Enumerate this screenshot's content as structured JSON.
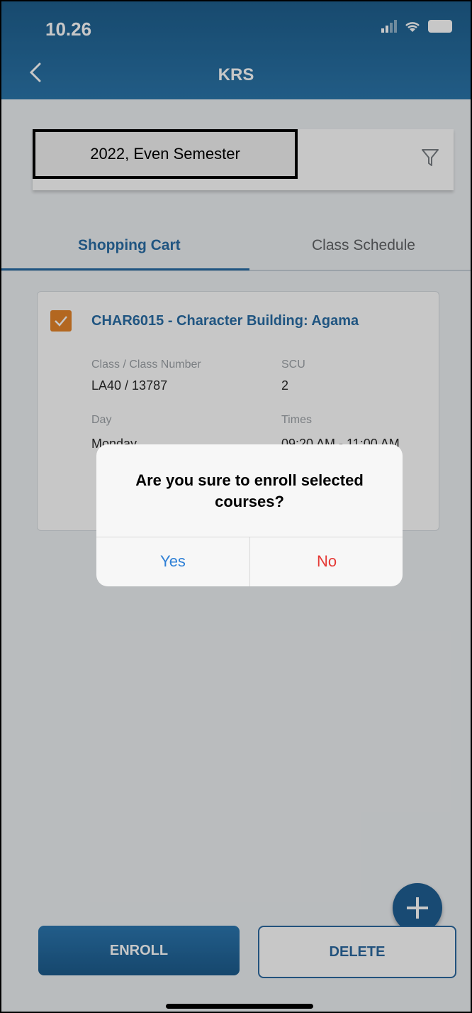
{
  "status_bar": {
    "time": "10.26"
  },
  "header": {
    "title": "KRS"
  },
  "semester": {
    "value": "2022, Even Semester"
  },
  "tabs": [
    {
      "label": "Shopping Cart",
      "active": true
    },
    {
      "label": "Class Schedule",
      "active": false
    }
  ],
  "course": {
    "title": "CHAR6015 - Character Building: Agama",
    "class_label": "Class / Class Number",
    "class_value": "LA40 / 13787",
    "scu_label": "SCU",
    "scu_value": "2",
    "day_label": "Day",
    "day_value": "Monday",
    "times_label": "Times",
    "times_value": "09:20 AM - 11:00 AM"
  },
  "actions": {
    "enroll": "ENROLL",
    "delete": "DELETE"
  },
  "dialog": {
    "message": "Are you sure to enroll selected courses?",
    "yes": "Yes",
    "no": "No"
  },
  "colors": {
    "header": "#2b76ab",
    "accent": "#2a6ea6",
    "checkbox": "#e6842a",
    "no": "#e53935",
    "yes": "#2f80d6"
  },
  "icons": [
    "back-chevron-icon",
    "filter-icon",
    "checkbox-checked-icon",
    "plus-icon"
  ]
}
